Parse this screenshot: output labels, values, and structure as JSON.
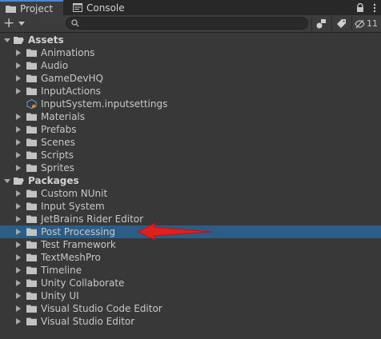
{
  "tabs": {
    "project": "Project",
    "console": "Console",
    "count": "11"
  },
  "toolbar": {
    "add_label": "+",
    "search_value": ""
  },
  "tree": [
    {
      "label": "Assets",
      "level": 0,
      "kind": "section",
      "expanded": true
    },
    {
      "label": "Animations",
      "level": 1,
      "kind": "folder"
    },
    {
      "label": "Audio",
      "level": 1,
      "kind": "folder"
    },
    {
      "label": "GameDevHQ",
      "level": 1,
      "kind": "folder"
    },
    {
      "label": "InputActions",
      "level": 1,
      "kind": "folder"
    },
    {
      "label": "InputSystem.inputsettings",
      "level": 1,
      "kind": "asset"
    },
    {
      "label": "Materials",
      "level": 1,
      "kind": "folder"
    },
    {
      "label": "Prefabs",
      "level": 1,
      "kind": "folder"
    },
    {
      "label": "Scenes",
      "level": 1,
      "kind": "folder"
    },
    {
      "label": "Scripts",
      "level": 1,
      "kind": "folder"
    },
    {
      "label": "Sprites",
      "level": 1,
      "kind": "folder"
    },
    {
      "label": "Packages",
      "level": 0,
      "kind": "section",
      "expanded": true
    },
    {
      "label": "Custom NUnit",
      "level": 1,
      "kind": "folder"
    },
    {
      "label": "Input System",
      "level": 1,
      "kind": "folder"
    },
    {
      "label": "JetBrains Rider Editor",
      "level": 1,
      "kind": "folder"
    },
    {
      "label": "Post Processing",
      "level": 1,
      "kind": "folder",
      "selected": true
    },
    {
      "label": "Test Framework",
      "level": 1,
      "kind": "folder"
    },
    {
      "label": "TextMeshPro",
      "level": 1,
      "kind": "folder"
    },
    {
      "label": "Timeline",
      "level": 1,
      "kind": "folder"
    },
    {
      "label": "Unity Collaborate",
      "level": 1,
      "kind": "folder"
    },
    {
      "label": "Unity UI",
      "level": 1,
      "kind": "folder"
    },
    {
      "label": "Visual Studio Code Editor",
      "level": 1,
      "kind": "folder"
    },
    {
      "label": "Visual Studio Editor",
      "level": 1,
      "kind": "folder"
    }
  ],
  "colors": {
    "accent": "#4a8ad4",
    "selection": "#2c5d87",
    "annotation": "#e0201c"
  }
}
